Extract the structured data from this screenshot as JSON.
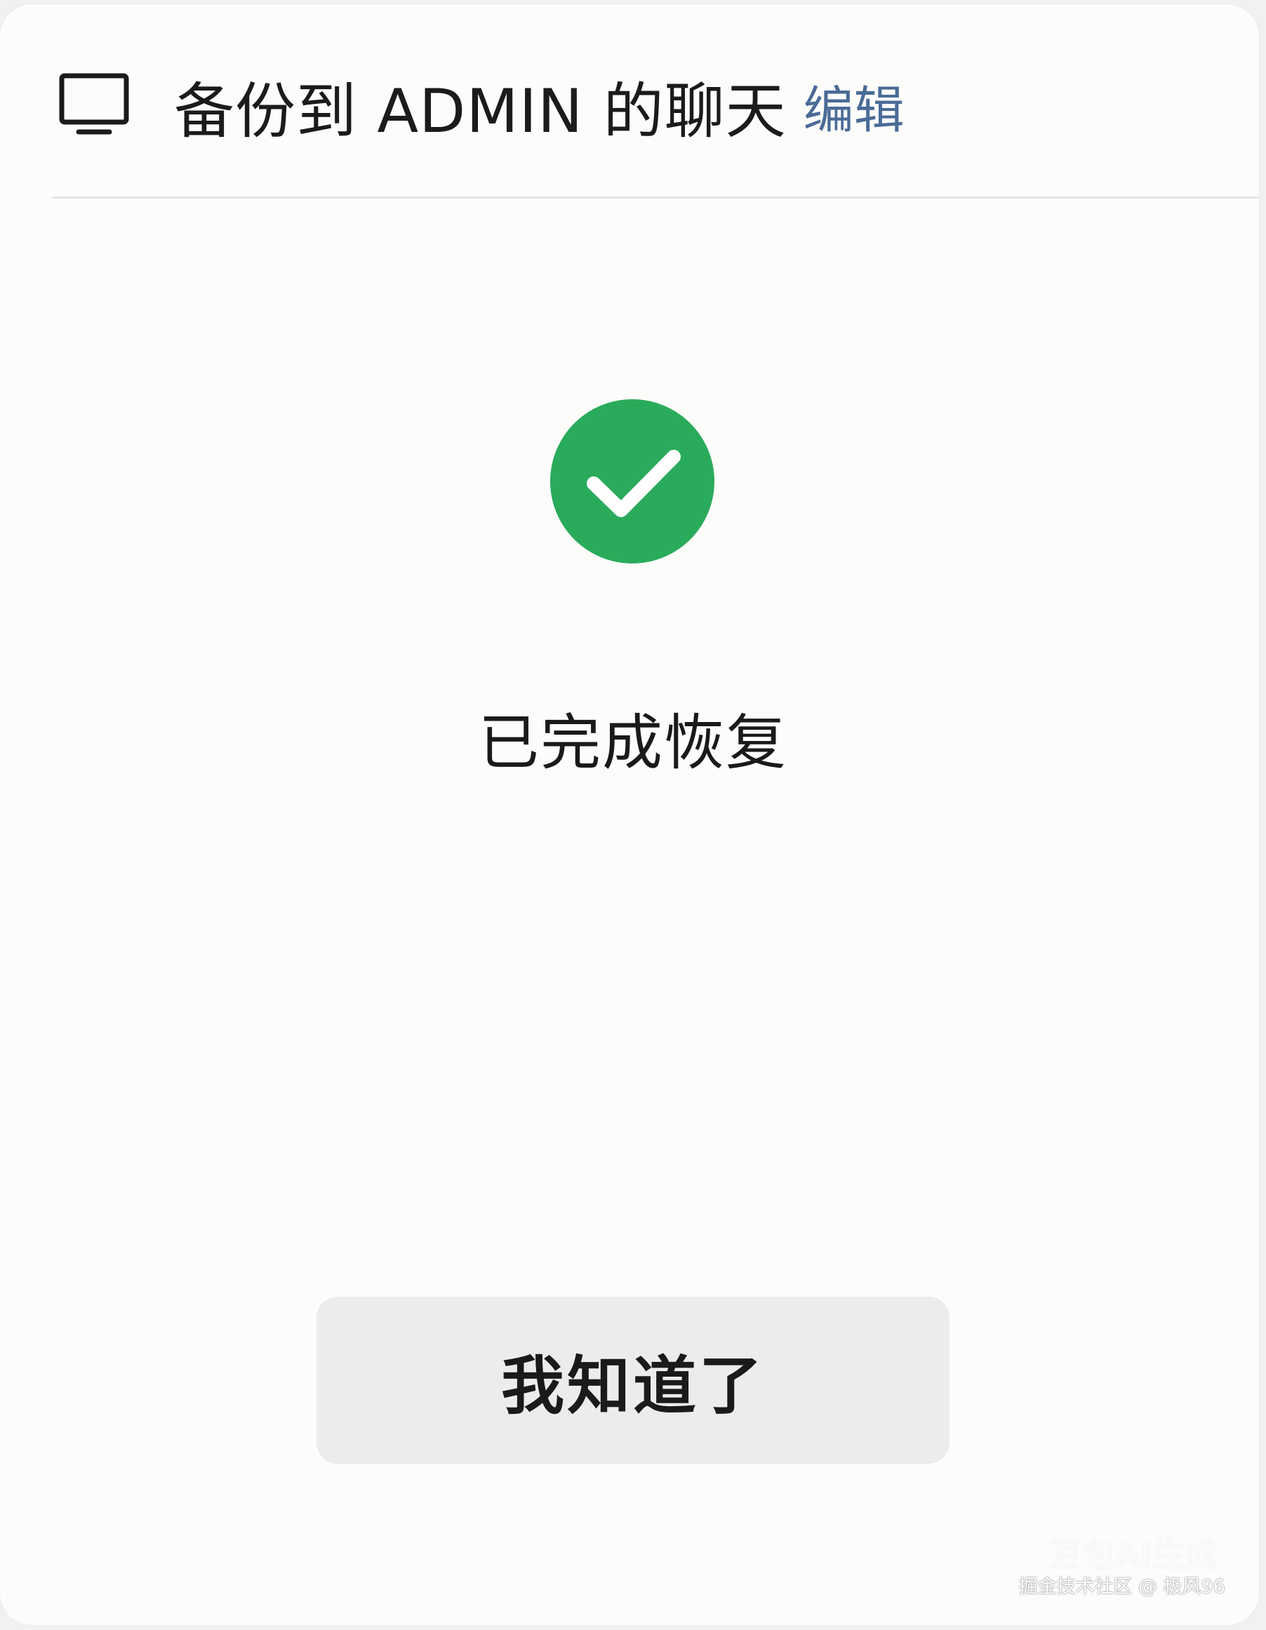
{
  "header": {
    "title": "备份到 ADMIN 的聊天",
    "edit_label": "编辑",
    "icon": "monitor-icon"
  },
  "status": {
    "icon": "check-circle-icon",
    "message": "已完成恢复"
  },
  "actions": {
    "confirm_label": "我知道了"
  },
  "watermark": {
    "badge": "豆包AI生成",
    "text": "掘金技术社区 @ 极风96"
  },
  "colors": {
    "accent": "#2aab5b",
    "edit_link": "#4a6b96",
    "button_bg": "#ececec",
    "panel_bg": "#fcfcfb"
  }
}
